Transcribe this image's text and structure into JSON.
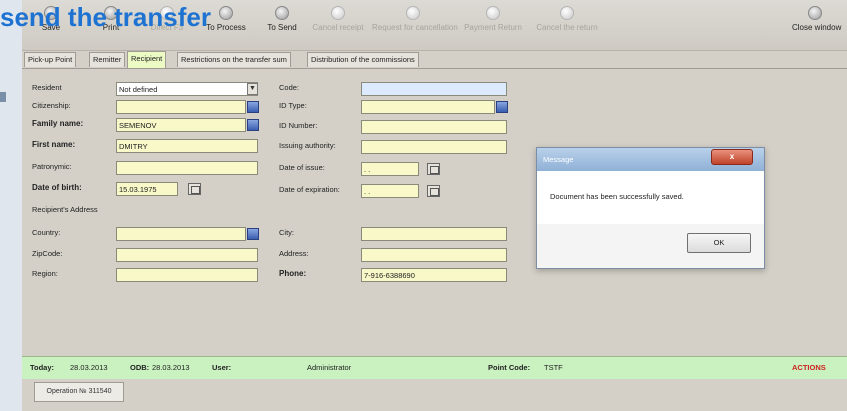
{
  "headline": "send the transfer",
  "toolbar": {
    "items": [
      {
        "label": "Save",
        "enabled": true
      },
      {
        "label": "Print",
        "enabled": true
      },
      {
        "label": "Direct F3",
        "enabled": false
      },
      {
        "label": "To Process",
        "enabled": true
      },
      {
        "label": "To Send",
        "enabled": true
      },
      {
        "label": "Cancel receipt",
        "enabled": false
      },
      {
        "label": "Request for cancellation",
        "enabled": false
      },
      {
        "label": "Payment Return",
        "enabled": false
      },
      {
        "label": "Cancel the return",
        "enabled": false
      },
      {
        "label": "Close window",
        "enabled": true
      }
    ]
  },
  "tabs": [
    "Pick-up Point",
    "Remitter",
    "Recipient",
    "Restrictions on the transfer sum",
    "Distribution of the commissions"
  ],
  "active_tab": "Recipient",
  "form": {
    "resident_label": "Resident",
    "resident_value": "Not defined",
    "citizenship_label": "Citizenship:",
    "family_name_label": "Family name:",
    "family_name_value": "SEMENOV",
    "first_name_label": "First name:",
    "first_name_value": "DMITRY",
    "patronymic_label": "Patronymic:",
    "dob_label": "Date of birth:",
    "dob_value": "15.03.1975",
    "address_label": "Recipient's Address",
    "country_label": "Country:",
    "zipcode_label": "ZipCode:",
    "region_label": "Region:",
    "code_label": "Code:",
    "id_type_label": "ID Type:",
    "id_number_label": "ID Number:",
    "issuing_label": "Issuing authority:",
    "date_issue_label": "Date of issue:",
    "date_issue_value": ". .",
    "date_exp_label": "Date of expiration:",
    "date_exp_value": ". .",
    "city_label": "City:",
    "address_field_label": "Address:",
    "phone_label": "Phone:",
    "phone_value": "7-916-6388690"
  },
  "status": {
    "today_label": "Today:",
    "today_value": "28.03.2013",
    "odb_label": "ODB:",
    "odb_value": "28.03.2013",
    "user_label": "User:",
    "user_value": "Administrator",
    "point_label": "Point Code:",
    "point_value": "TSTF",
    "action_label": "ACTIONS"
  },
  "operation_tab": "Operation № 311540",
  "dialog": {
    "title": "Message",
    "close": "x",
    "message": "Document has been successfully saved.",
    "ok": "OK"
  }
}
